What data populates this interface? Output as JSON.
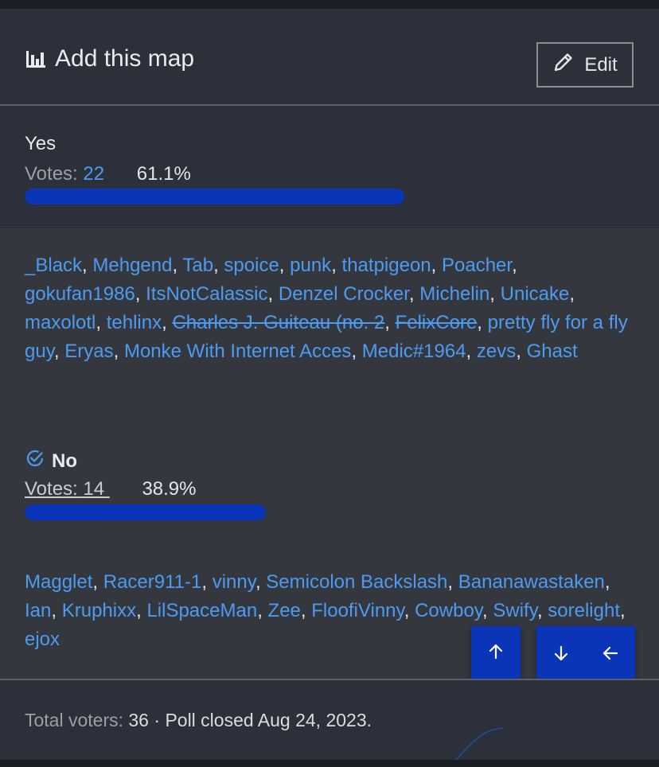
{
  "header": {
    "title": "Add this map",
    "title_icon": "bar-chart-icon",
    "edit_label": "Edit",
    "edit_icon": "pencil-icon"
  },
  "options": [
    {
      "label": "Yes",
      "votes_label": "Votes:",
      "votes": "22",
      "percent": "61.1%",
      "fraction": 0.611,
      "selected": false,
      "voters": [
        {
          "name": "_Black",
          "struck": false
        },
        {
          "name": "Mehgend",
          "struck": false
        },
        {
          "name": "Tab",
          "struck": false
        },
        {
          "name": "spoice",
          "struck": false
        },
        {
          "name": "punk",
          "struck": false
        },
        {
          "name": "thatpigeon",
          "struck": false
        },
        {
          "name": "Poacher",
          "struck": false
        },
        {
          "name": "gokufan1986",
          "struck": false
        },
        {
          "name": "ItsNotCalassic",
          "struck": false
        },
        {
          "name": "Denzel Crocker",
          "struck": false
        },
        {
          "name": "Michelin",
          "struck": false
        },
        {
          "name": "Unicake",
          "struck": false
        },
        {
          "name": "maxolotl",
          "struck": false
        },
        {
          "name": "tehlinx",
          "struck": false
        },
        {
          "name": "Charles J. Guiteau (no. 2",
          "struck": true
        },
        {
          "name": "FelixCore",
          "struck": true
        },
        {
          "name": "pretty fly for a fly guy",
          "struck": false
        },
        {
          "name": "Eryas",
          "struck": false
        },
        {
          "name": "Monke With Internet Acces",
          "struck": false
        },
        {
          "name": "Medic#1964",
          "struck": false
        },
        {
          "name": "zevs",
          "struck": false
        },
        {
          "name": "Ghast",
          "struck": false
        }
      ]
    },
    {
      "label": "No",
      "votes_label": "Votes:",
      "votes": "14",
      "percent": "38.9%",
      "fraction": 0.389,
      "selected": true,
      "selected_icon": "check-circle-icon",
      "voters": [
        {
          "name": "Magglet",
          "struck": false
        },
        {
          "name": "Racer911-1",
          "struck": false
        },
        {
          "name": "vinny",
          "struck": false
        },
        {
          "name": "Semicolon Backslash",
          "struck": false
        },
        {
          "name": "Bananawastaken",
          "struck": false
        },
        {
          "name": "Ian",
          "struck": false
        },
        {
          "name": "Kruphixx",
          "struck": false
        },
        {
          "name": "LilSpaceMan",
          "struck": false
        },
        {
          "name": "Zee",
          "struck": false
        },
        {
          "name": "FloofiVinny",
          "struck": false
        },
        {
          "name": "Cowboy",
          "struck": false
        },
        {
          "name": "Swify",
          "struck": false
        },
        {
          "name": "sorelight",
          "struck": false
        },
        {
          "name": "ejox",
          "struck": false
        }
      ]
    }
  ],
  "nav_buttons": [
    {
      "icon": "arrow-up-icon"
    },
    {
      "icon": "arrow-down-icon"
    },
    {
      "icon": "arrow-left-icon"
    }
  ],
  "footer": {
    "total_label": "Total voters:",
    "total": "36",
    "separator": "·",
    "closed_text": "Poll closed Aug 24, 2023."
  },
  "colors": {
    "accent": "#0a35b8",
    "link": "#4d9bf0",
    "background": "#2b303a",
    "voters_background": "#34383e"
  }
}
